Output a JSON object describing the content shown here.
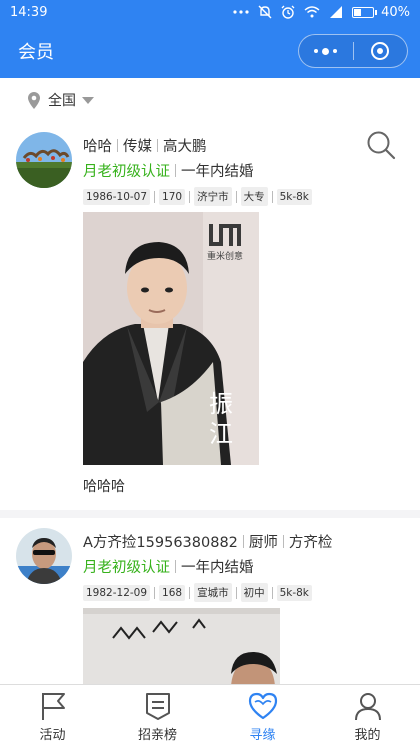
{
  "status_bar": {
    "time": "14:39",
    "battery": "40%",
    "battery_level": 0.4
  },
  "header": {
    "title": "会员"
  },
  "location": {
    "label": "全国"
  },
  "feed": [
    {
      "name": "哈哈",
      "job": "传媒",
      "height_label": "高大鹏",
      "verification": "月老初级认证",
      "marriage_plan": "一年内结婚",
      "tags": [
        "1986-10-07",
        "170",
        "济宁市",
        "大专",
        "5k-8k"
      ],
      "photo_brand": "重米创意",
      "photo_text": [
        "振",
        "江"
      ],
      "nickname": "哈哈哈"
    },
    {
      "name": "A方齐捡15956380882",
      "job": "厨师",
      "height_label": "方齐检",
      "verification": "月老初级认证",
      "marriage_plan": "一年内结婚",
      "tags": [
        "1982-12-09",
        "168",
        "宣城市",
        "初中",
        "5k-8k"
      ]
    }
  ],
  "tabbar": {
    "items": [
      {
        "label": "活动",
        "icon": "flag-icon"
      },
      {
        "label": "招亲榜",
        "icon": "board-icon"
      },
      {
        "label": "寻缘",
        "icon": "heart-icon",
        "active": true
      },
      {
        "label": "我的",
        "icon": "user-icon"
      }
    ]
  }
}
